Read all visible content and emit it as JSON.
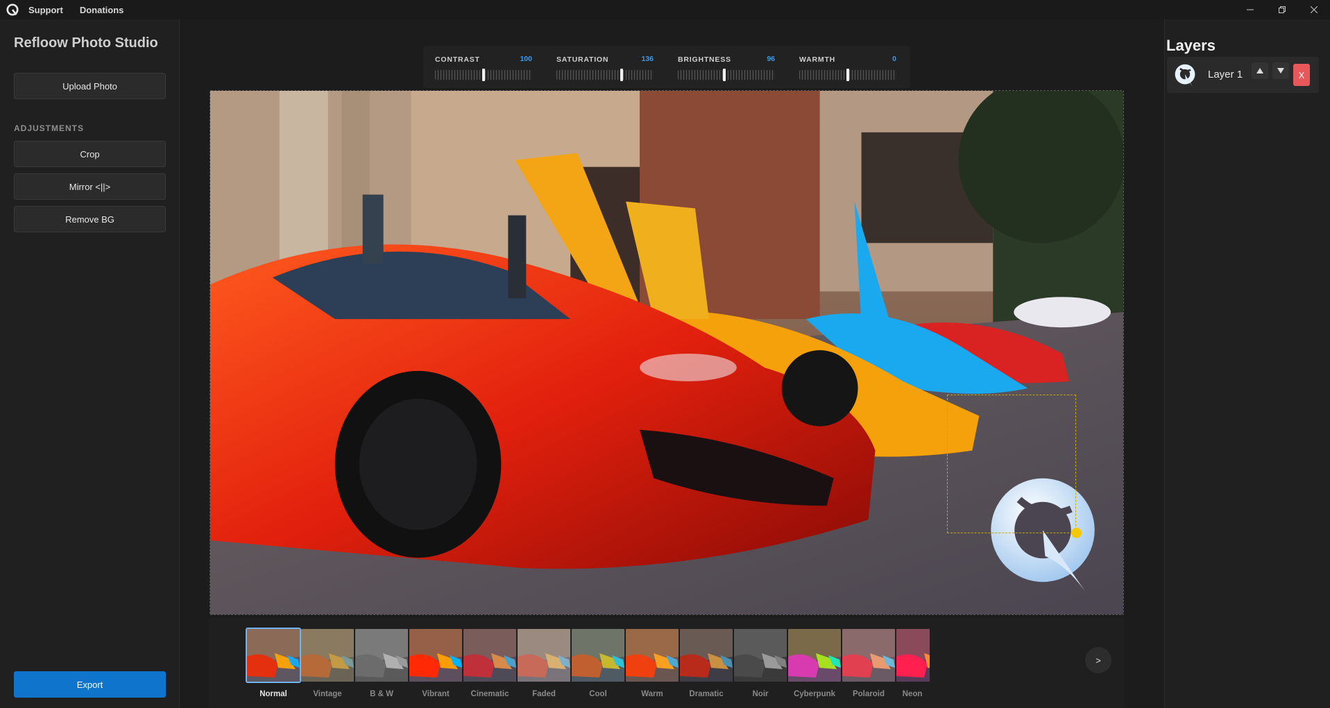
{
  "titlebar": {
    "menu": [
      "Support",
      "Donations"
    ],
    "controls": [
      "minimize-icon",
      "restore-icon",
      "close-icon"
    ]
  },
  "sidebar": {
    "title": "Refloow Photo Studio",
    "upload_label": "Upload Photo",
    "section_label": "ADJUSTMENTS",
    "crop_label": "Crop",
    "mirror_label": "Mirror <||>",
    "remove_bg_label": "Remove BG",
    "export_label": "Export"
  },
  "adjustments": [
    {
      "label": "CONTRAST",
      "value": "100",
      "level": 0.5
    },
    {
      "label": "SATURATION",
      "value": "136",
      "level": 0.68
    },
    {
      "label": "BRIGHTNESS",
      "value": "96",
      "level": 0.48
    },
    {
      "label": "WARMTH",
      "value": "0",
      "level": 0.5
    }
  ],
  "filters": [
    {
      "name": "Normal",
      "active": true
    },
    {
      "name": "Vintage"
    },
    {
      "name": "B & W"
    },
    {
      "name": "Vibrant"
    },
    {
      "name": "Cinematic"
    },
    {
      "name": "Faded"
    },
    {
      "name": "Cool"
    },
    {
      "name": "Warm"
    },
    {
      "name": "Dramatic"
    },
    {
      "name": "Noir"
    },
    {
      "name": "Cyberpunk"
    },
    {
      "name": "Polaroid"
    },
    {
      "name": "Neon"
    }
  ],
  "filters_next_label": ">",
  "layers": {
    "title": "Layers",
    "items": [
      {
        "name": "Layer 1",
        "delete_label": "X"
      }
    ]
  },
  "colors": {
    "accent": "#0e74cc",
    "value_blue": "#3d9be9",
    "delete_red": "#e8585a",
    "handle_yellow": "#f5c800"
  }
}
